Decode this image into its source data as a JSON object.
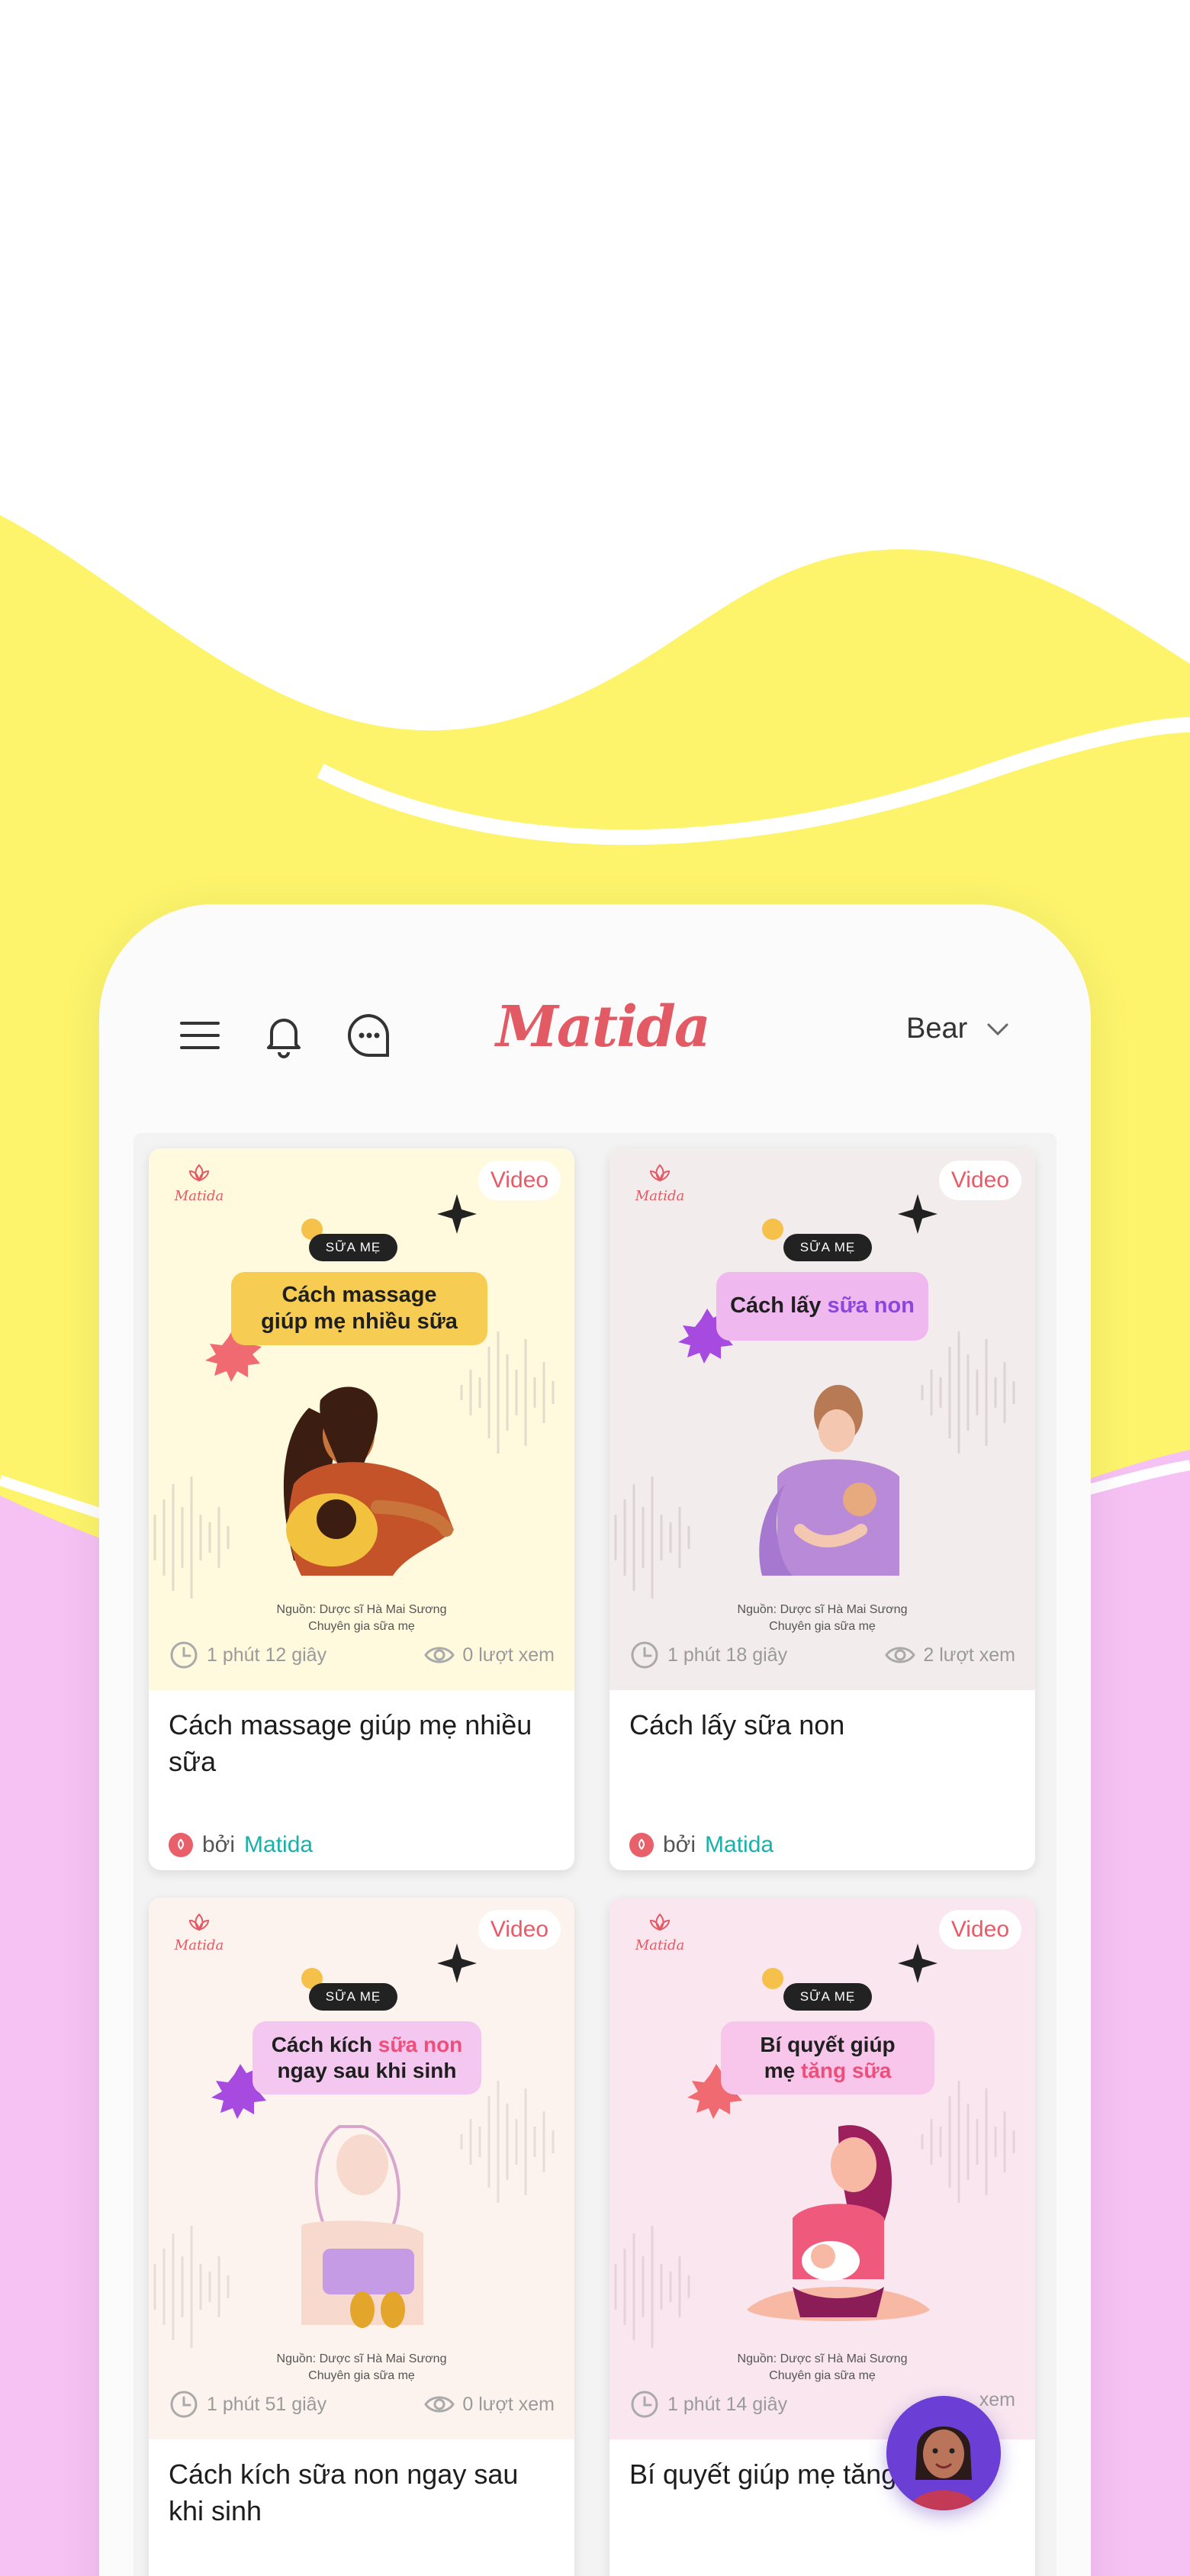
{
  "app": {
    "logo_text": "Matida",
    "profile_name": "Bear",
    "colors": {
      "brand": "#e15a64",
      "author_link": "#1ab0aa",
      "badge": "#e95a66",
      "fab": "#6b3fd6"
    }
  },
  "header": {
    "icons": [
      "menu-icon",
      "bell-icon",
      "chat-icon"
    ]
  },
  "cards": [
    {
      "badge": "Video",
      "brand": "Matida",
      "tag": "SỮA MẸ",
      "headline_line1": "Cách massage",
      "headline_line2": "giúp mẹ nhiều sữa",
      "source_line1": "Nguồn: Dược sĩ Hà Mai Sương",
      "source_line2": "Chuyên gia sữa mẹ",
      "duration": "1 phút 12 giây",
      "views": "0 lượt xem",
      "title": "Cách massage giúp mẹ nhiều sữa",
      "author_prefix": "bởi",
      "author": "Matida"
    },
    {
      "badge": "Video",
      "brand": "Matida",
      "tag": "SỮA MẸ",
      "headline_a": "Cách lấy ",
      "headline_hl": "sữa non",
      "source_line1": "Nguồn: Dược sĩ Hà Mai Sương",
      "source_line2": "Chuyên gia sữa mẹ",
      "duration": "1 phút 18 giây",
      "views": "2 lượt xem",
      "title": "Cách lấy sữa non",
      "author_prefix": "bởi",
      "author": "Matida"
    },
    {
      "badge": "Video",
      "brand": "Matida",
      "tag": "SỮA MẸ",
      "headline_a": "Cách kích ",
      "headline_hl": "sữa non",
      "headline_line2": "ngay sau khi sinh",
      "source_line1": "Nguồn: Dược sĩ Hà Mai Sương",
      "source_line2": "Chuyên gia sữa mẹ",
      "duration": "1 phút 51 giây",
      "views": "0 lượt xem",
      "title": "Cách kích sữa non ngay sau khi sinh"
    },
    {
      "badge": "Video",
      "brand": "Matida",
      "tag": "SỮA MẸ",
      "headline_line1": "Bí quyết giúp",
      "headline_a": "mẹ ",
      "headline_hl": "tăng sữa",
      "source_line1": "Nguồn: Dược sĩ Hà Mai Sương",
      "source_line2": "Chuyên gia sữa mẹ",
      "duration": "1 phút 14 giây",
      "views": "xem",
      "title": "Bí quyết giúp mẹ tăng"
    }
  ]
}
